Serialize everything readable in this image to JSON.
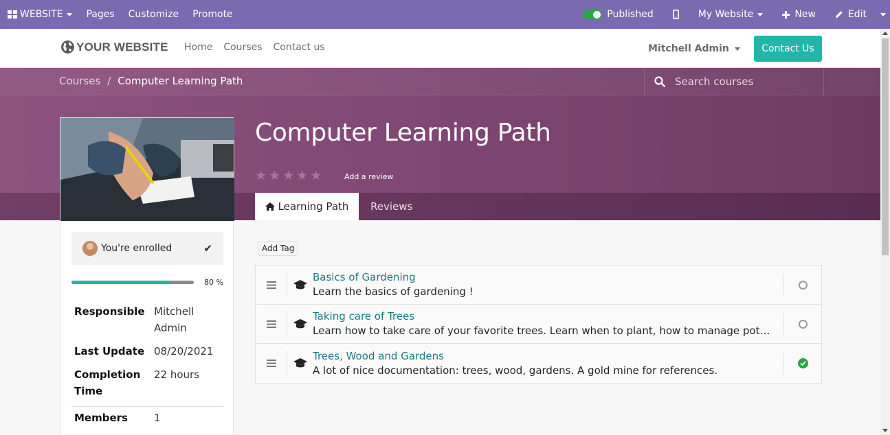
{
  "adminbar": {
    "website_label": "WEBSITE",
    "pages_label": "Pages",
    "customize_label": "Customize",
    "promote_label": "Promote",
    "published_label": "Published",
    "my_website_label": "My Website",
    "new_label": "New",
    "edit_label": "Edit"
  },
  "header": {
    "logo_text": "YOUR WEBSITE",
    "nav": [
      "Home",
      "Courses",
      "Contact us"
    ],
    "user_name": "Mitchell Admin",
    "contact_button": "Contact Us"
  },
  "breadcrumb": {
    "root": "Courses",
    "separator": "/",
    "current": "Computer Learning Path"
  },
  "search": {
    "placeholder": "Search courses"
  },
  "course": {
    "title": "Computer Learning Path",
    "rating_stars_filled": 0,
    "rating_stars_total": 5,
    "add_review": "Add a review",
    "tabs": {
      "learning_path": "Learning Path",
      "reviews": "Reviews"
    }
  },
  "sidebar": {
    "enrolled_text": "You're enrolled",
    "progress_percent": 80,
    "progress_label": "80 %",
    "info": [
      {
        "key": "Responsible",
        "value": "Mitchell Admin"
      },
      {
        "key": "Last Update",
        "value": "08/20/2021"
      },
      {
        "key": "Completion Time",
        "value": "22 hours"
      },
      {
        "key": "Members",
        "value": "1"
      }
    ]
  },
  "content": {
    "add_tag": "Add Tag",
    "items": [
      {
        "title": "Basics of Gardening",
        "description": "Learn the basics of gardening !",
        "completed": false
      },
      {
        "title": "Taking care of Trees",
        "description": "Learn how to take care of your favorite trees. Learn when to plant, how to manage potted tree…",
        "completed": false
      },
      {
        "title": "Trees, Wood and Gardens",
        "description": "A lot of nice documentation: trees, wood, gardens. A gold mine for references.",
        "completed": true
      }
    ]
  },
  "colors": {
    "admin_bar": "#7a6bb0",
    "banner": "#7d4672",
    "accent_teal": "#21b6a8",
    "link": "#1d7a83",
    "success": "#28a745"
  }
}
